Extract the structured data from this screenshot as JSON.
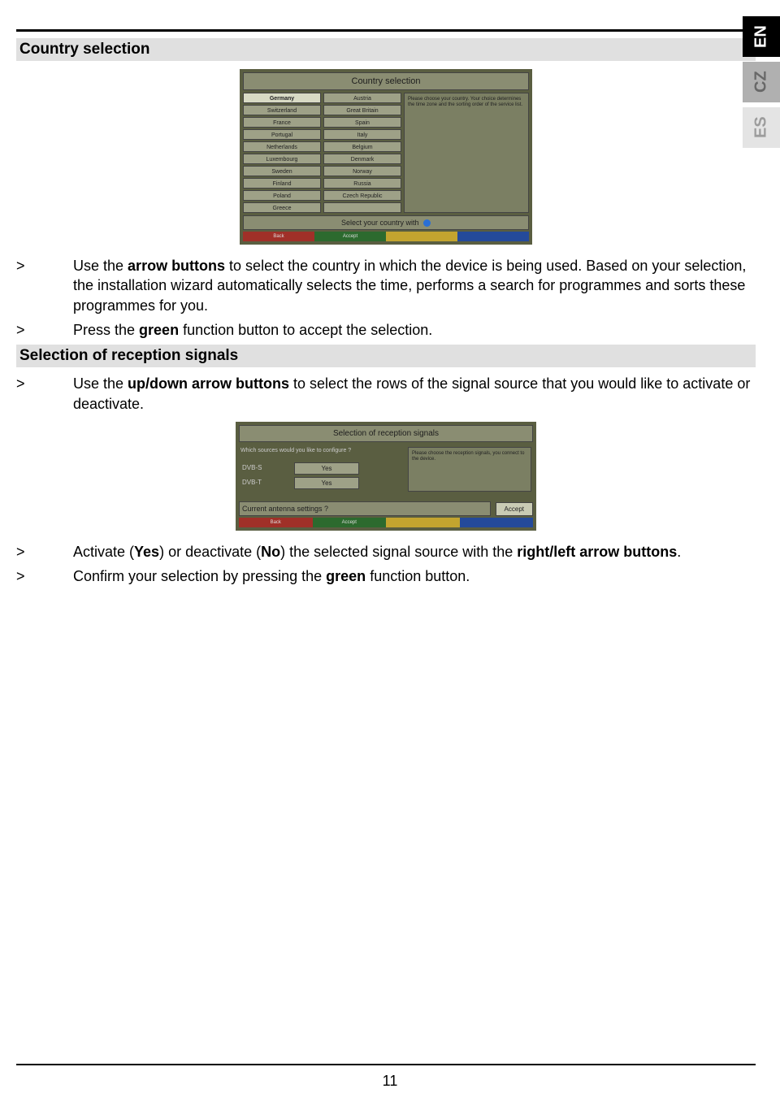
{
  "lang_tabs": {
    "en": "EN",
    "cz": "CZ",
    "es": "ES"
  },
  "section1_title": "Country selection",
  "shot1": {
    "title": "Country selection",
    "col1": [
      "Germany",
      "Switzerland",
      "France",
      "Portugal",
      "Netherlands",
      "Luxembourg",
      "Sweden",
      "Finland",
      "Poland",
      "Greece"
    ],
    "col2": [
      "Austria",
      "Great Britain",
      "Spain",
      "Italy",
      "Belgium",
      "Denmark",
      "Norway",
      "Russia",
      "Czech Republic",
      ""
    ],
    "hint": "Please choose your country. Your choice determines the time zone and the sorting order of the service list.",
    "footer": "Select your country with",
    "cb": {
      "back": "Back",
      "accept": "Accept"
    }
  },
  "bullets1": [
    {
      "marker": ">",
      "parts": [
        "Use the ",
        {
          "b": "arrow buttons"
        },
        " to select the country in which the device is being used. Based on your selection, the installation wizard automatically selects the time, performs a search for programmes and sorts these programmes for you."
      ]
    },
    {
      "marker": ">",
      "parts": [
        "Press the ",
        {
          "b": "green"
        },
        " function button to accept the selection."
      ]
    }
  ],
  "section2_title": "Selection of reception signals",
  "bullets2": [
    {
      "marker": ">",
      "parts": [
        "Use the ",
        {
          "b": "up/down arrow buttons"
        },
        " to select the rows of the signal source that you would like to activate or deactivate."
      ]
    }
  ],
  "shot2": {
    "title": "Selection of reception signals",
    "question": "Which sources would you like to configure ?",
    "rows": [
      {
        "label": "DVB-S",
        "value": "Yes"
      },
      {
        "label": "DVB-T",
        "value": "Yes"
      }
    ],
    "hint": "Please choose the reception signals, you connect to the device.",
    "footer_text": "Current antenna settings ?",
    "accept": "Accept",
    "cb": {
      "back": "Back",
      "accept": "Accept"
    }
  },
  "bullets3": [
    {
      "marker": ">",
      "parts": [
        "Activate (",
        {
          "b": "Yes"
        },
        ") or deactivate (",
        {
          "b": "No"
        },
        ") the selected signal source with the ",
        {
          "b": "right/left arrow buttons"
        },
        "."
      ]
    },
    {
      "marker": ">",
      "parts": [
        "Confirm your selection by pressing the ",
        {
          "b": "green"
        },
        " function button."
      ]
    }
  ],
  "page_number": "11"
}
